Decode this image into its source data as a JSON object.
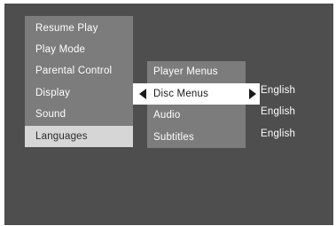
{
  "main_menu": {
    "items": [
      {
        "label": "Resume Play"
      },
      {
        "label": "Play Mode"
      },
      {
        "label": "Parental Control"
      },
      {
        "label": "Display"
      },
      {
        "label": "Sound"
      },
      {
        "label": "Languages",
        "selected": true
      }
    ]
  },
  "languages_submenu": {
    "items": [
      {
        "label": "Player Menus",
        "value": ""
      },
      {
        "label": "Disc Menus",
        "value": "English",
        "highlighted": true
      },
      {
        "label": "Audio",
        "value": "English"
      },
      {
        "label": "Subtitles",
        "value": "English"
      }
    ]
  },
  "icons": {
    "left_arrow": "triangle-left-icon",
    "right_arrow": "triangle-right-icon"
  },
  "colors": {
    "screen_background": "#4e4e4e",
    "menu_panel": "#7c7c7c",
    "selected_item": "#d6d6d6",
    "highlight_item": "#ffffff",
    "text": "#ffffff"
  }
}
